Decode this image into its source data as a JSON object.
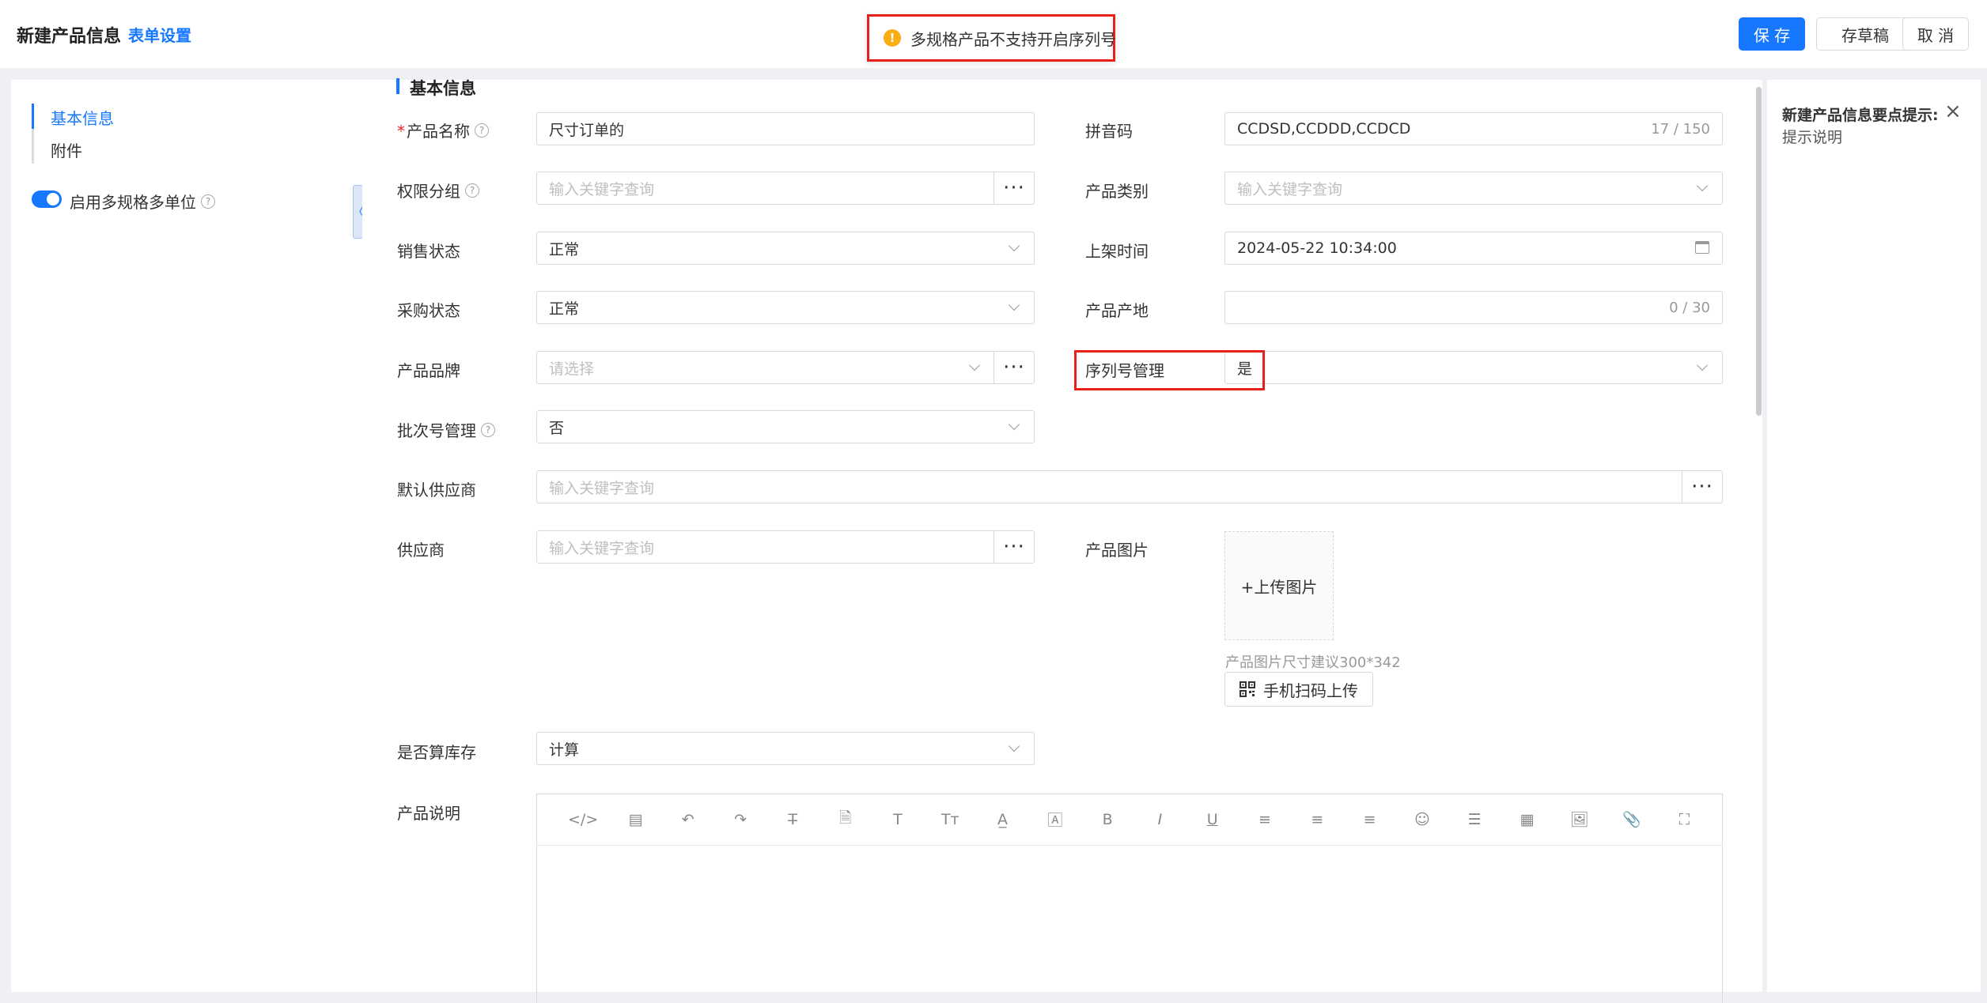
{
  "header": {
    "title": "新建产品信息",
    "form_settings": "表单设置",
    "save": "保 存",
    "draft": "存草稿",
    "cancel": "取 消"
  },
  "toast": {
    "icon": "warning-icon",
    "message": "多规格产品不支持开启序列号",
    "color": "#faad14"
  },
  "sidebar": {
    "items": [
      {
        "label": "基本信息",
        "active": true
      },
      {
        "label": "附件",
        "active": false
      }
    ],
    "toggle_label": "启用多规格多单位",
    "toggle_on": true
  },
  "section": {
    "title": "基本信息"
  },
  "form": {
    "product_name": {
      "label": "产品名称",
      "value": "尺寸订单的"
    },
    "pinyin": {
      "label": "拼音码",
      "value": "CCDSD,CCDDD,CCDCD",
      "count": "17 / 150"
    },
    "permission_group": {
      "label": "权限分组",
      "placeholder": "输入关键字查询"
    },
    "category": {
      "label": "产品类别",
      "placeholder": "输入关键字查询"
    },
    "sales_status": {
      "label": "销售状态",
      "value": "正常"
    },
    "shelf_time": {
      "label": "上架时间",
      "value": "2024-05-22 10:34:00"
    },
    "purchase_status": {
      "label": "采购状态",
      "value": "正常"
    },
    "origin": {
      "label": "产品产地",
      "count": "0 / 30"
    },
    "brand": {
      "label": "产品品牌",
      "placeholder": "请选择"
    },
    "serial_mgmt": {
      "label": "序列号管理",
      "value": "是"
    },
    "batch_mgmt": {
      "label": "批次号管理",
      "value": "否"
    },
    "default_supplier": {
      "label": "默认供应商",
      "placeholder": "输入关键字查询"
    },
    "supplier": {
      "label": "供应商",
      "placeholder": "输入关键字查询"
    },
    "product_image": {
      "label": "产品图片",
      "upload": "+上传图片",
      "hint": "产品图片尺寸建议300*342",
      "scan": "手机扫码上传"
    },
    "count_stock": {
      "label": "是否算库存",
      "value": "计算"
    },
    "description": {
      "label": "产品说明"
    }
  },
  "editor_toolbar": [
    "</>",
    "▤",
    "↶",
    "↷",
    "T̶",
    "🗎",
    "T",
    "Tт",
    "A̲",
    "🄰",
    "B",
    "I",
    "U",
    "≡",
    "≡",
    "≡",
    "☺",
    "☰",
    "▦",
    "🖼",
    "📎",
    "⛶"
  ],
  "tips": {
    "title": "新建产品信息要点提示:",
    "desc": "提示说明",
    "close": "×"
  }
}
